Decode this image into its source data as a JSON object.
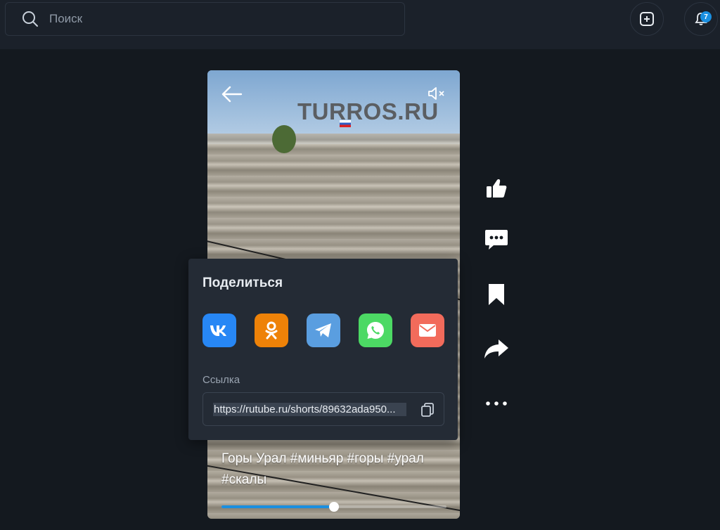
{
  "search": {
    "placeholder": "Поиск",
    "icon": "search-icon"
  },
  "header": {
    "add_icon": "add-video-icon",
    "bell_icon": "bell-icon",
    "notification_count": "7",
    "accent": "#1a8fe0"
  },
  "video": {
    "watermark": "TURROS.RU",
    "caption": "Горы Урал #миньяр #горы #урал #скалы",
    "progress": 0.5,
    "back_icon": "arrow-left-icon",
    "mute_icon": "muted-speaker-icon"
  },
  "actions": [
    {
      "icon": "thumbs-up-icon"
    },
    {
      "icon": "comment-icon"
    },
    {
      "icon": "bookmark-icon"
    },
    {
      "icon": "share-icon"
    },
    {
      "icon": "more-icon"
    }
  ],
  "share": {
    "title": "Поделиться",
    "networks": [
      {
        "name": "vk",
        "color": "#2787f5"
      },
      {
        "name": "odnoklassniki",
        "color": "#ee8208"
      },
      {
        "name": "telegram",
        "color": "#5a9ee0"
      },
      {
        "name": "whatsapp",
        "color": "#4cd964"
      },
      {
        "name": "email",
        "color": "#f26b5b"
      }
    ],
    "link_label": "Ссылка",
    "link": "https://rutube.ru/shorts/89632ada950...",
    "copy_icon": "copy-icon"
  }
}
